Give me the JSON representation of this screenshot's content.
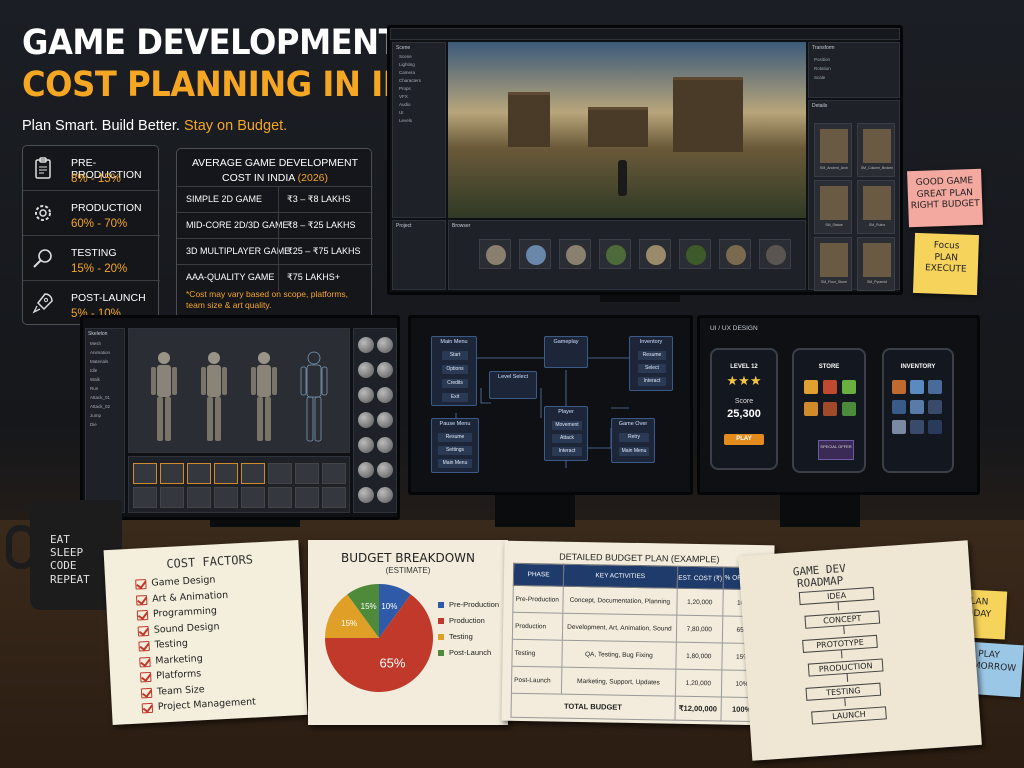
{
  "headline": {
    "line1": "GAME DEVELOPMENT",
    "line2": "COST PLANNING IN INDIA",
    "tagline_a": "Plan Smart. Build Better. ",
    "tagline_b": "Stay on Budget."
  },
  "phases": [
    {
      "name": "PRE-PRODUCTION",
      "pct": "8% - 15%",
      "icon": "clipboard-icon"
    },
    {
      "name": "PRODUCTION",
      "pct": "60% - 70%",
      "icon": "gear-icon"
    },
    {
      "name": "TESTING",
      "pct": "15% - 20%",
      "icon": "magnifier-icon"
    },
    {
      "name": "POST-LAUNCH",
      "pct": "5% - 10%",
      "icon": "rocket-icon"
    }
  ],
  "avg_cost": {
    "title": "AVERAGE GAME DEVELOPMENT",
    "title2": "COST IN INDIA ",
    "year": "(2026)",
    "rows": [
      {
        "type": "SIMPLE 2D GAME",
        "range": "₹3 – ₹8 LAKHS"
      },
      {
        "type": "MID-CORE 2D/3D GAME",
        "range": "₹8 – ₹25 LAKHS"
      },
      {
        "type": "3D MULTIPLAYER GAME",
        "range": "₹25 – ₹75 LAKHS"
      },
      {
        "type": "AAA-QUALITY GAME",
        "range": "₹75 LAKHS+"
      }
    ],
    "note": "*Cost may vary based on scope, platforms, team size & art quality."
  },
  "editor": {
    "scene_tab": "Scene",
    "hierarchy": [
      "Scene",
      "Lighting",
      "Camera",
      "Characters",
      "Props",
      "VFX",
      "Audio",
      "UI",
      "Levels"
    ],
    "inspector": "Transform",
    "inspector_rows": [
      "Position",
      "Rotation",
      "Scale"
    ],
    "details": "Details",
    "asset_labels": [
      "SM_Ancient_Arch",
      "SM_Column_Broken",
      "SM_Statue",
      "SM_Ruins",
      "SM_Floor_Stone",
      "SM_Pyramid"
    ],
    "project": "Project",
    "browser": "Browser"
  },
  "char_editor": {
    "tab": "Skeleton",
    "list": [
      "Mesh",
      "Animation",
      "Materials",
      "Idle",
      "Walk",
      "Run",
      "Attack_01",
      "Attack_02",
      "Jump",
      "Die"
    ]
  },
  "flow": {
    "main_menu": "Main Menu",
    "main_items": [
      "Start",
      "Options",
      "Credits",
      "Exit"
    ],
    "gameplay": "Gameplay",
    "inventory": "Inventory",
    "inv_items": [
      "Resume",
      "Select",
      "Interact"
    ],
    "level_select": "Level Select",
    "player": "Player",
    "player_items": [
      "Movement",
      "Attack",
      "Interact"
    ],
    "pause_menu": "Pause Menu",
    "pause_items": [
      "Resume",
      "Settings",
      "Main Menu"
    ],
    "game_over": "Game Over",
    "over_items": [
      "Retry",
      "Main Menu"
    ]
  },
  "uiux": {
    "title": "UI / UX DESIGN",
    "level": "LEVEL 12",
    "score_label": "Score",
    "score": "25,300",
    "play": "PLAY",
    "store": "STORE",
    "special": "SPECIAL OFFER",
    "inventory": "INVENTORY"
  },
  "cost_factors": {
    "title": "COST FACTORS",
    "items": [
      "Game Design",
      "Art & Animation",
      "Programming",
      "Sound Design",
      "Testing",
      "Marketing",
      "Platforms",
      "Team Size",
      "Project Management"
    ]
  },
  "budget": {
    "title": "BUDGET BREAKDOWN",
    "subtitle": "(ESTIMATE)"
  },
  "chart_data": {
    "type": "pie",
    "title": "BUDGET BREAKDOWN",
    "subtitle": "(ESTIMATE)",
    "categories": [
      "Pre-Production",
      "Production",
      "Testing",
      "Post-Launch"
    ],
    "values": [
      10,
      65,
      15,
      10
    ],
    "labels": [
      "10%",
      "65%",
      "15%",
      "15%"
    ],
    "colors": [
      "#2e5aa8",
      "#c0392b",
      "#e0a028",
      "#4e8a3a"
    ],
    "legend_position": "right"
  },
  "detailed": {
    "title": "DETAILED BUDGET PLAN (EXAMPLE)",
    "headers": [
      "PHASE",
      "KEY ACTIVITIES",
      "EST. COST (₹)",
      "% OF TOTAL"
    ],
    "rows": [
      [
        "Pre-Production",
        "Concept, Documentation, Planning",
        "1,20,000",
        "10%"
      ],
      [
        "Production",
        "Development, Art, Animation, Sound",
        "7,80,000",
        "65%"
      ],
      [
        "Testing",
        "QA, Testing, Bug Fixing",
        "1,80,000",
        "15%"
      ],
      [
        "Post-Launch",
        "Marketing, Support, Updates",
        "1,20,000",
        "10%"
      ]
    ],
    "total_label": "TOTAL BUDGET",
    "total_cost": "₹12,00,000",
    "total_pct": "100%"
  },
  "roadmap": {
    "title_a": "GAME DEV",
    "title_b": "ROADMAP",
    "steps": [
      "IDEA",
      "CONCEPT",
      "PROTOTYPE",
      "PRODUCTION",
      "TESTING",
      "LAUNCH"
    ]
  },
  "stickies": {
    "red": [
      "GOOD GAME",
      "GREAT PLAN",
      "RIGHT BUDGET"
    ],
    "yellow": [
      "Focus",
      "PLAN",
      "EXECUTE"
    ],
    "green": [
      "PLAN",
      "TODAY"
    ],
    "blue": [
      "PLAY",
      "TOMORROW"
    ]
  },
  "mug": [
    "EAT",
    "SLEEP",
    "CODE",
    "REPEAT"
  ]
}
